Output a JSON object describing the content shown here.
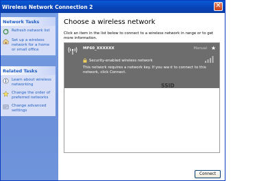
{
  "window": {
    "title": "Wireless Network Connection 2",
    "close_glyph": "✕"
  },
  "left_pane": {
    "network_tasks": {
      "heading": "Network Tasks",
      "items": [
        {
          "label": "Refresh network list",
          "icon": "refresh-icon"
        },
        {
          "label": "Set up a wireless network for a home or small office",
          "icon": "setup-wireless-icon"
        }
      ]
    },
    "related_tasks": {
      "heading": "Related Tasks",
      "items": [
        {
          "label": "Learn about wireless networking",
          "icon": "info-icon"
        },
        {
          "label": "Change the order of preferred networks",
          "icon": "star-icon"
        },
        {
          "label": "Change advanced settings",
          "icon": "settings-icon"
        }
      ]
    }
  },
  "main": {
    "title": "Choose a wireless network",
    "description": "Click an item in the list below to connect to a wireless network in range or to get more information.",
    "networks": [
      {
        "ssid": "MF60_XXXXXX",
        "mode": "Manual",
        "security": "Security-enabled wireless network",
        "message": "This network requires a network key. If you want to connect to this network, click Connect.",
        "selected": true
      }
    ],
    "annotation": "SSID",
    "connect_label": "Connect"
  },
  "colors": {
    "title_bar": "#0a4fc7",
    "left_pane": "#6f94dc",
    "panel_body": "#d6dff7",
    "link_blue": "#215dc6",
    "selected_row": "#6d6d6d"
  }
}
